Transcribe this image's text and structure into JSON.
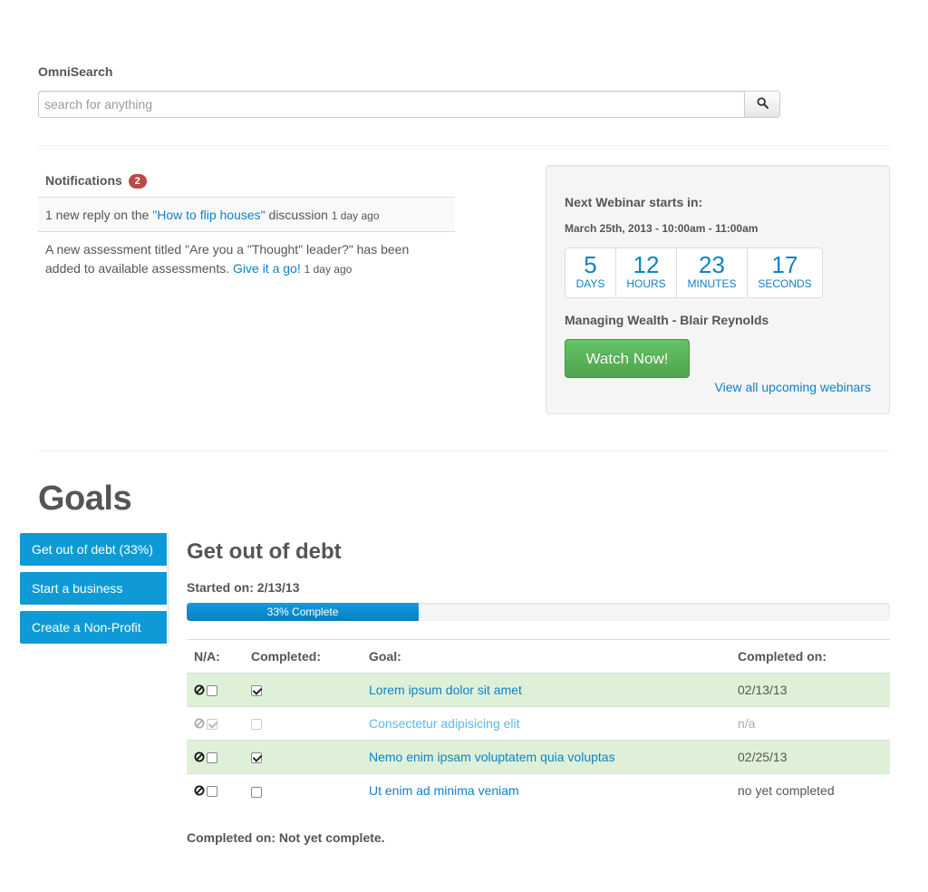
{
  "search": {
    "label": "OmniSearch",
    "placeholder": "search for anything",
    "icon": "search-icon"
  },
  "notifications": {
    "title": "Notifications",
    "count": "2",
    "badge_color": "#b94a48",
    "items": [
      {
        "prefix": "1 new reply on the ",
        "link": "\"How to flip houses\"",
        "suffix": " discussion ",
        "time": "1 day ago"
      },
      {
        "prefix": "A new assessment titled \"Are you a \"Thought\" leader?\" has been added to available assessments. ",
        "link": "Give it a go!",
        "suffix": " ",
        "time": "1 day ago"
      }
    ]
  },
  "webinar": {
    "title": "Next Webinar starts in:",
    "date": "March 25th, 2013 - 10:00am - 11:00am",
    "countdown": [
      {
        "value": "5",
        "unit": "DAYS"
      },
      {
        "value": "12",
        "unit": "HOURS"
      },
      {
        "value": "23",
        "unit": "MINUTES"
      },
      {
        "value": "17",
        "unit": "SECONDS"
      }
    ],
    "speaker": "Managing Wealth - Blair Reynolds",
    "watch_label": "Watch Now!",
    "view_all_label": "View all upcoming webinars",
    "accent_color": "#0e82c7",
    "button_color": "#5bb75b"
  },
  "goals": {
    "title": "Goals",
    "tabs": [
      {
        "label": "Get out of debt (33%)"
      },
      {
        "label": "Start a business"
      },
      {
        "label": "Create a Non-Profit"
      }
    ],
    "tab_color": "#0e9ad6",
    "detail": {
      "title": "Get out of debt",
      "started": "Started on: 2/13/13",
      "progress": 0.33,
      "progress_label": "33% Complete",
      "columns": [
        "N/A:",
        "Completed:",
        "Goal:",
        "Completed on:"
      ],
      "rows": [
        {
          "na_checked": false,
          "completed": true,
          "goal": "Lorem ipsum dolor sit amet",
          "completed_on": "02/13/13",
          "state": "success"
        },
        {
          "na_checked": true,
          "completed": false,
          "goal": "Consectetur adipisicing elit",
          "completed_on": "n/a",
          "state": "muted"
        },
        {
          "na_checked": false,
          "completed": true,
          "goal": "Nemo enim ipsam voluptatem quia voluptas",
          "completed_on": "02/25/13",
          "state": "success"
        },
        {
          "na_checked": false,
          "completed": false,
          "goal": "Ut enim ad minima veniam",
          "completed_on": "no yet completed",
          "state": "normal"
        }
      ],
      "footer": "Completed on: Not yet complete."
    }
  }
}
